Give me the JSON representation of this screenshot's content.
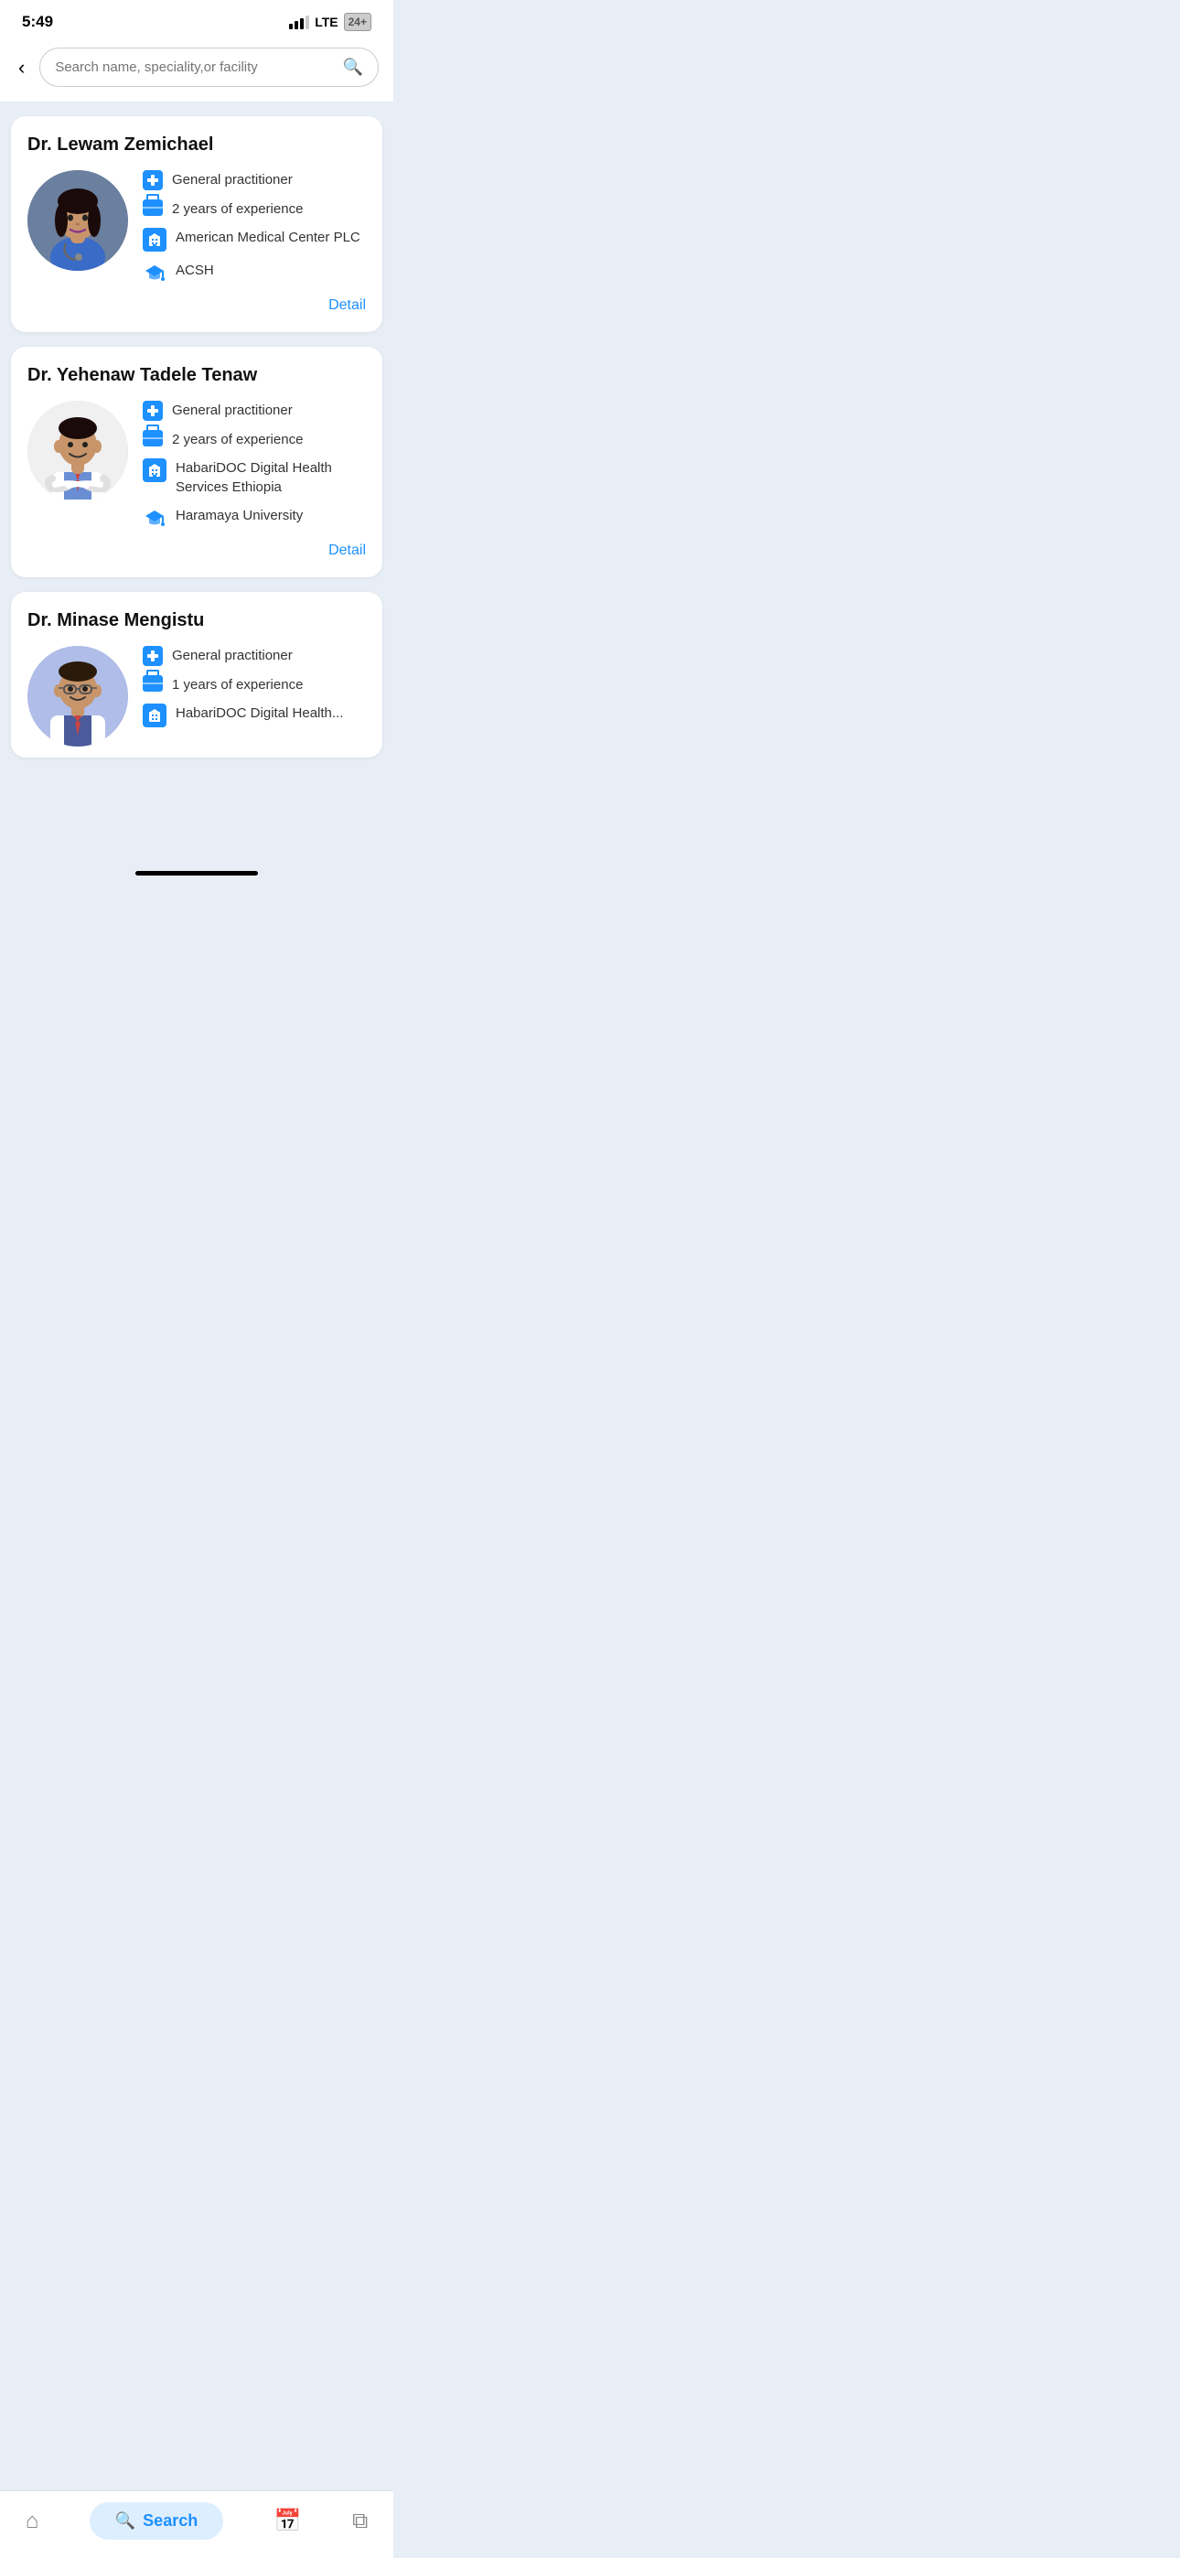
{
  "statusBar": {
    "time": "5:49",
    "network": "LTE",
    "battery": "24"
  },
  "searchBar": {
    "placeholder": "Search name, speciality,or facility",
    "backLabel": "←"
  },
  "doctors": [
    {
      "id": "doctor-1",
      "name": "Dr. Lewam Zemichael",
      "specialty": "General practitioner",
      "experience": "2 years of experience",
      "facility": "American Medical Center PLC",
      "education": "ACSH",
      "detailLabel": "Detail",
      "avatarType": "female"
    },
    {
      "id": "doctor-2",
      "name": "Dr. Yehenaw Tadele Tenaw",
      "specialty": "General practitioner",
      "experience": "2 years of experience",
      "facility": "HabariDOC Digital Health Services Ethiopia",
      "education": "Haramaya University",
      "detailLabel": "Detail",
      "avatarType": "male-cartoon"
    },
    {
      "id": "doctor-3",
      "name": "Dr. Minase Mengistu",
      "specialty": "General practitioner",
      "experience": "1 years of experience",
      "facility": "HabariDOC Digital Health...",
      "education": "",
      "detailLabel": "",
      "avatarType": "male-glasses"
    }
  ],
  "bottomNav": {
    "homeLabel": "Home",
    "searchLabel": "Search",
    "calendarLabel": "Calendar",
    "cardsLabel": "Cards"
  }
}
